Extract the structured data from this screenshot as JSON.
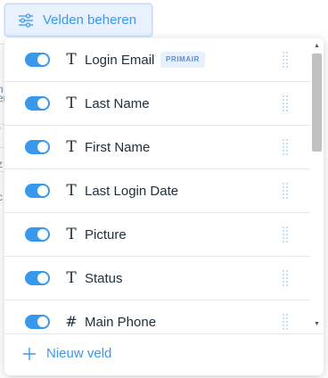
{
  "colors": {
    "accent": "#3899ec",
    "button_bg": "#e8f1fd",
    "badge_bg": "#e7f0fd",
    "text": "#20303c",
    "divider": "#e4e8ec"
  },
  "background_table": {
    "glyphs": [
      "n",
      "er",
      "r",
      "z",
      "c"
    ]
  },
  "manage_button": {
    "label": "Velden beheren",
    "icon": "sliders-icon"
  },
  "fields": [
    {
      "label": "Login Email",
      "type_icon": "text-type-icon",
      "glyph": "T",
      "enabled": true,
      "badge": "PRIMAIR"
    },
    {
      "label": "Last Name",
      "type_icon": "text-type-icon",
      "glyph": "T",
      "enabled": true
    },
    {
      "label": "First Name",
      "type_icon": "text-type-icon",
      "glyph": "T",
      "enabled": true
    },
    {
      "label": "Last Login Date",
      "type_icon": "text-type-icon",
      "glyph": "T",
      "enabled": true
    },
    {
      "label": "Picture",
      "type_icon": "text-type-icon",
      "glyph": "T",
      "enabled": true
    },
    {
      "label": "Status",
      "type_icon": "text-type-icon",
      "glyph": "T",
      "enabled": true
    },
    {
      "label": "Main Phone",
      "type_icon": "number-type-icon",
      "glyph": "#",
      "enabled": true
    }
  ],
  "footer": {
    "add_label": "Nieuw veld",
    "add_icon": "plus-icon"
  }
}
